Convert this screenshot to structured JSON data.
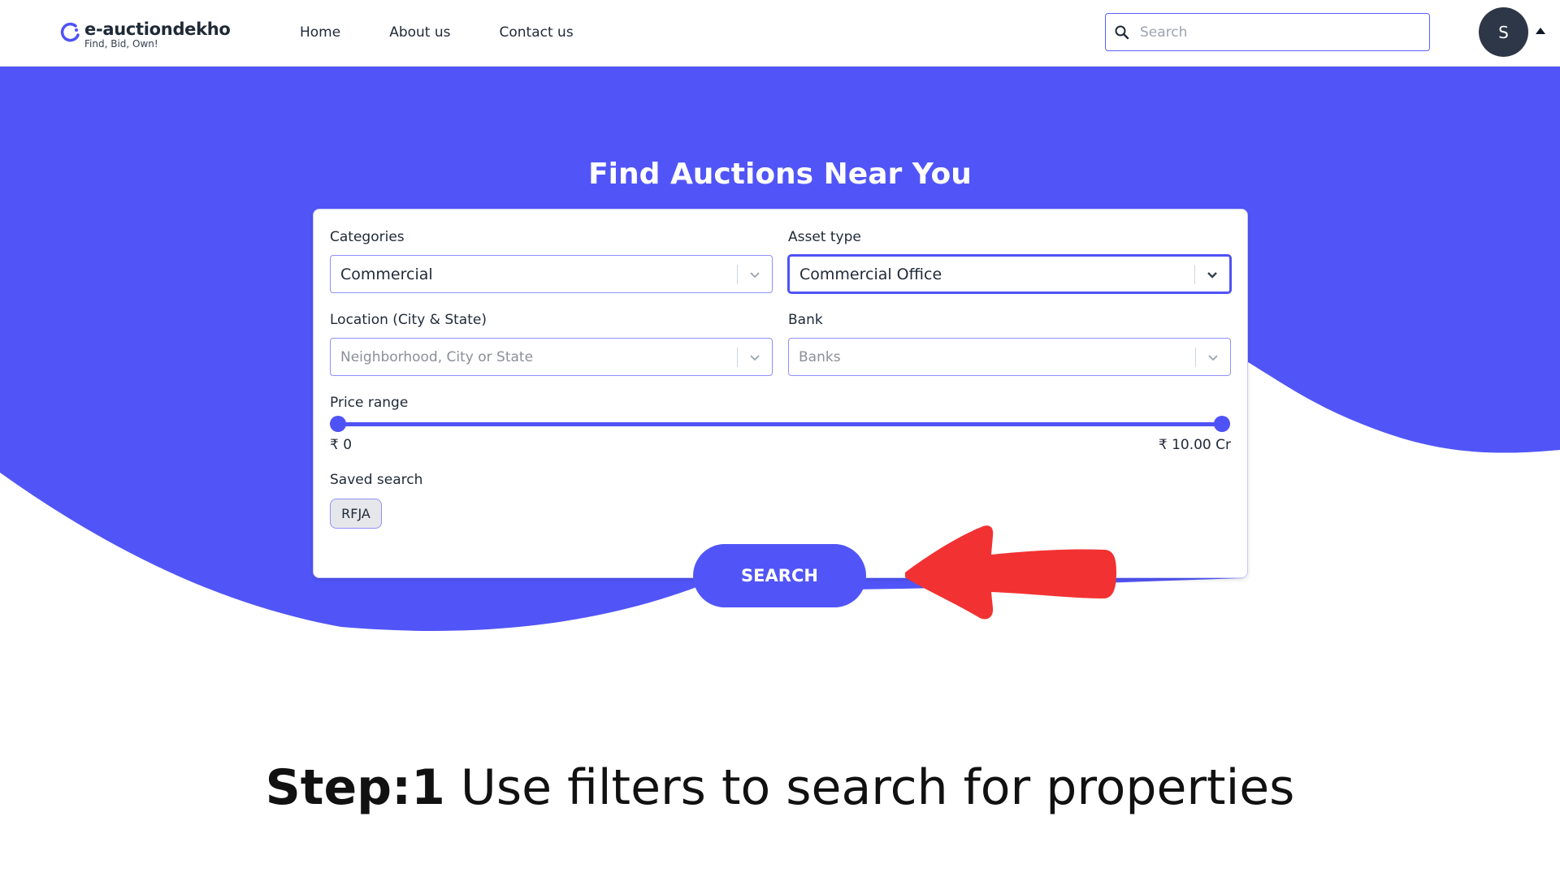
{
  "header": {
    "logo_name": "e-auctiondekho",
    "logo_tagline": "Find, Bid, Own!",
    "nav": [
      "Home",
      "About us",
      "Contact us"
    ],
    "search_placeholder": "Search",
    "avatar_initial": "S"
  },
  "hero": {
    "title": "Find Auctions Near You"
  },
  "filters": {
    "categories_label": "Categories",
    "categories_value": "Commercial",
    "asset_type_label": "Asset type",
    "asset_type_value": "Commercial Office",
    "location_label": "Location (City & State)",
    "location_placeholder": "Neighborhood, City or State",
    "bank_label": "Bank",
    "bank_placeholder": "Banks",
    "price_label": "Price range",
    "price_min": "₹ 0",
    "price_max": "₹ 10.00 Cr",
    "saved_label": "Saved search",
    "saved_chip": "RFJA",
    "search_button": "SEARCH"
  },
  "caption": {
    "step_bold": "Step:1",
    "step_text": " Use filters to search for properties"
  },
  "colors": {
    "brand": "#5155F7",
    "arrow": "#F23232",
    "avatar": "#2D3748"
  },
  "icons": [
    "logo-icon",
    "search-icon",
    "chevron-down-icon",
    "caret-up-icon",
    "red-arrow-icon"
  ]
}
